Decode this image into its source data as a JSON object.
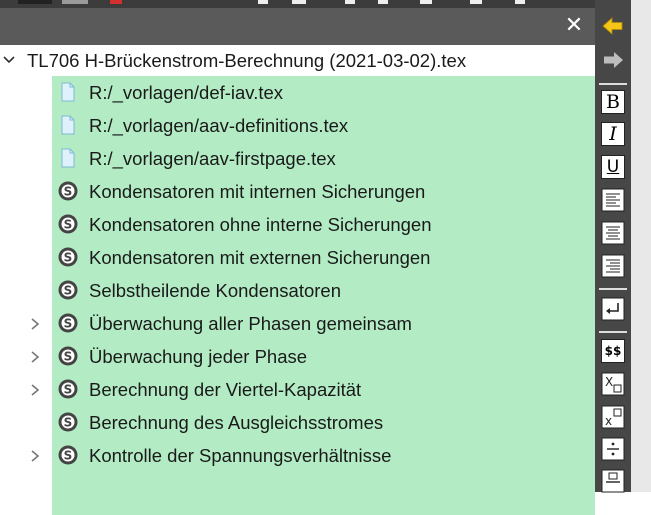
{
  "panel": {
    "close_glyph": "✕"
  },
  "tree": {
    "root": {
      "label": "TL706 H-Brückenstrom-Berechnung (2021-03-02).tex",
      "expanded": true
    },
    "children": [
      {
        "label": "R:/_vorlagen/def-iav.tex",
        "icon": "file-icon",
        "expandable": false
      },
      {
        "label": "R:/_vorlagen/aav-definitions.tex",
        "icon": "file-icon",
        "expandable": false
      },
      {
        "label": "R:/_vorlagen/aav-firstpage.tex",
        "icon": "file-icon",
        "expandable": false
      },
      {
        "label": "Kondensatoren mit internen Sicherungen",
        "icon": "section-icon",
        "expandable": false
      },
      {
        "label": "Kondensatoren ohne interne Sicherungen",
        "icon": "section-icon",
        "expandable": false
      },
      {
        "label": "Kondensatoren mit externen Sicherungen",
        "icon": "section-icon",
        "expandable": false
      },
      {
        "label": "Selbstheilende Kondensatoren",
        "icon": "section-icon",
        "expandable": false
      },
      {
        "label": "Überwachung aller Phasen gemeinsam",
        "icon": "section-icon",
        "expandable": true
      },
      {
        "label": "Überwachung jeder Phase",
        "icon": "section-icon",
        "expandable": true
      },
      {
        "label": "Berechnung der Viertel-Kapazität",
        "icon": "section-icon",
        "expandable": true
      },
      {
        "label": "Berechnung des Ausgleichsstromes",
        "icon": "section-icon",
        "expandable": false
      },
      {
        "label": "Kontrolle der Spannungsverhältnisse",
        "icon": "section-icon",
        "expandable": true
      }
    ]
  },
  "sidebar": {
    "bold_label": "B",
    "italic_label": "I",
    "underline_label": "U",
    "math_label": "$$",
    "items": [
      "back-arrow-icon",
      "forward-arrow-icon",
      "bold-icon",
      "italic-icon",
      "underline-icon",
      "align-left-icon",
      "align-center-icon",
      "align-right-icon",
      "newline-icon",
      "math-inline-icon",
      "subscript-icon",
      "superscript-icon",
      "divide-icon",
      "fraction-icon"
    ]
  },
  "colors": {
    "selection": "#b3ecc4",
    "header": "#5a5a5a",
    "sidebar": "#474747",
    "accent_arrow": "#f5c518"
  }
}
